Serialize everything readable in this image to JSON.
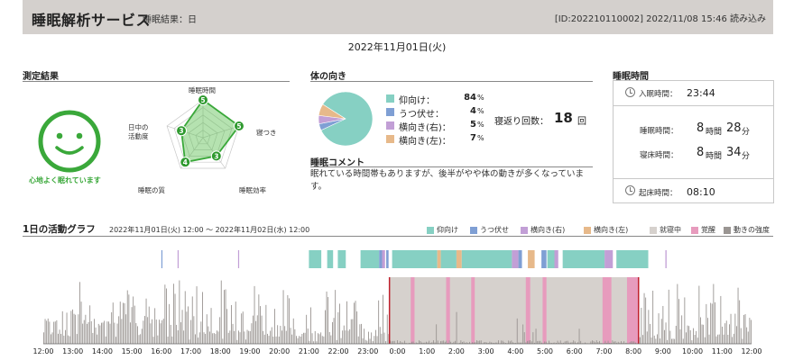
{
  "header": {
    "app_title": "睡眠解析サービス",
    "subtitle": "睡眠結果：日",
    "meta": "[ID:202210110002]  2022/11/08 15:46 読み込み"
  },
  "date": "2022年11月01日(火)",
  "measurement": {
    "title": "測定結果",
    "face_label": "心地よく眠れています",
    "radar": {
      "max": 5,
      "axes": [
        {
          "label": "睡眠時間",
          "score": "5"
        },
        {
          "label": "寝つき",
          "score": "5"
        },
        {
          "label": "睡眠効率",
          "score": "3"
        },
        {
          "label": "睡眠の質",
          "score": "4"
        },
        {
          "label": "日中の\n活動度",
          "score": "3"
        }
      ]
    }
  },
  "orientation": {
    "title": "体の向き",
    "items": [
      {
        "name": "仰向け：",
        "pct": "84",
        "unit": "%",
        "color": "#86d0c3"
      },
      {
        "name": "うつ伏せ：",
        "pct": "4",
        "unit": "%",
        "color": "#7f9fd4"
      },
      {
        "name": "横向き(右)：",
        "pct": "5",
        "unit": "%",
        "color": "#c29fd6"
      },
      {
        "name": "横向き(左)：",
        "pct": "7",
        "unit": "%",
        "color": "#e7b98a"
      }
    ],
    "toss_label": "寝返り回数：",
    "toss_count": "18",
    "toss_unit": "回"
  },
  "comment": {
    "title": "睡眠コメント",
    "text": "眠れている時間帯もありますが、後半がやや体の動きが多くなっています。"
  },
  "sleep_time": {
    "title": "睡眠時間",
    "bed_in_label": "入眠時間：",
    "bed_in": "23:44",
    "sleep_label": "睡眠時間：",
    "sleep_h": "8",
    "sleep_h_unit": "時間",
    "sleep_m": "28",
    "sleep_m_unit": "分",
    "bed_label": "寝床時間：",
    "bed_h": "8",
    "bed_h_unit": "時間",
    "bed_m": "34",
    "bed_m_unit": "分",
    "wake_label": "起床時間：",
    "wake": "08:10"
  },
  "activity": {
    "title": "1日の活動グラフ",
    "range": "2022年11月01日(火) 12:00 ～ 2022年11月02日(水) 12:00",
    "legend": [
      {
        "label": "仰向け",
        "color": "#86d0c3"
      },
      {
        "label": "うつ伏せ",
        "color": "#7f9fd4"
      },
      {
        "label": "横向き(右)",
        "color": "#c29fd6"
      },
      {
        "label": "横向き(左)",
        "color": "#e7b98a"
      },
      {
        "label": "就寝中",
        "color": "#d6d1cd"
      },
      {
        "label": "覚醒",
        "color": "#e79bbd"
      },
      {
        "label": "動きの強度",
        "color": "#9a9592"
      }
    ],
    "ticks": [
      "12:00",
      "13:00",
      "14:00",
      "15:00",
      "16:00",
      "17:00",
      "18:00",
      "19:00",
      "20:00",
      "21:00",
      "22:00",
      "23:00",
      "0:00",
      "1:00",
      "2:00",
      "3:00",
      "4:00",
      "5:00",
      "6:00",
      "7:00",
      "8:00",
      "9:00",
      "10:00",
      "11:00",
      "12:00"
    ],
    "posture_segments": [
      {
        "start": 4.0,
        "end": 4.03,
        "color": "#7f9fd4"
      },
      {
        "start": 4.55,
        "end": 4.58,
        "color": "#c29fd6"
      },
      {
        "start": 6.6,
        "end": 6.63,
        "color": "#c29fd6"
      },
      {
        "start": 9.0,
        "end": 9.42,
        "color": "#86d0c3"
      },
      {
        "start": 9.62,
        "end": 9.82,
        "color": "#86d0c3"
      },
      {
        "start": 9.98,
        "end": 10.25,
        "color": "#86d0c3"
      },
      {
        "start": 10.75,
        "end": 11.38,
        "color": "#86d0c3"
      },
      {
        "start": 11.38,
        "end": 11.48,
        "color": "#7f9fd4"
      },
      {
        "start": 11.48,
        "end": 11.58,
        "color": "#c29fd6"
      },
      {
        "start": 11.62,
        "end": 11.7,
        "color": "#7f9fd4"
      },
      {
        "start": 11.82,
        "end": 13.35,
        "color": "#86d0c3"
      },
      {
        "start": 13.35,
        "end": 13.47,
        "color": "#e7b98a"
      },
      {
        "start": 13.47,
        "end": 14.0,
        "color": "#86d0c3"
      },
      {
        "start": 14.0,
        "end": 14.18,
        "color": "#e7b98a"
      },
      {
        "start": 14.18,
        "end": 15.88,
        "color": "#86d0c3"
      },
      {
        "start": 15.88,
        "end": 16.1,
        "color": "#c29fd6"
      },
      {
        "start": 16.1,
        "end": 16.22,
        "color": "#7f9fd4"
      },
      {
        "start": 16.42,
        "end": 16.65,
        "color": "#e7b98a"
      },
      {
        "start": 16.88,
        "end": 17.05,
        "color": "#7f9fd4"
      },
      {
        "start": 17.08,
        "end": 17.32,
        "color": "#86d0c3"
      },
      {
        "start": 17.32,
        "end": 17.45,
        "color": "#c29fd6"
      },
      {
        "start": 17.6,
        "end": 19.02,
        "color": "#86d0c3"
      },
      {
        "start": 19.02,
        "end": 19.3,
        "color": "#c29fd6"
      },
      {
        "start": 19.42,
        "end": 20.5,
        "color": "#86d0c3"
      },
      {
        "start": 21.08,
        "end": 21.12,
        "color": "#c29fd6"
      }
    ],
    "sleep_window": {
      "start": 11.73,
      "end": 20.17
    },
    "wake_segments": [
      {
        "start": 12.45,
        "end": 12.58
      },
      {
        "start": 13.65,
        "end": 13.78
      },
      {
        "start": 14.5,
        "end": 14.62
      },
      {
        "start": 16.35,
        "end": 16.5
      },
      {
        "start": 16.92,
        "end": 17.05
      },
      {
        "start": 18.95,
        "end": 19.25
      },
      {
        "start": 19.78,
        "end": 20.15
      }
    ]
  }
}
